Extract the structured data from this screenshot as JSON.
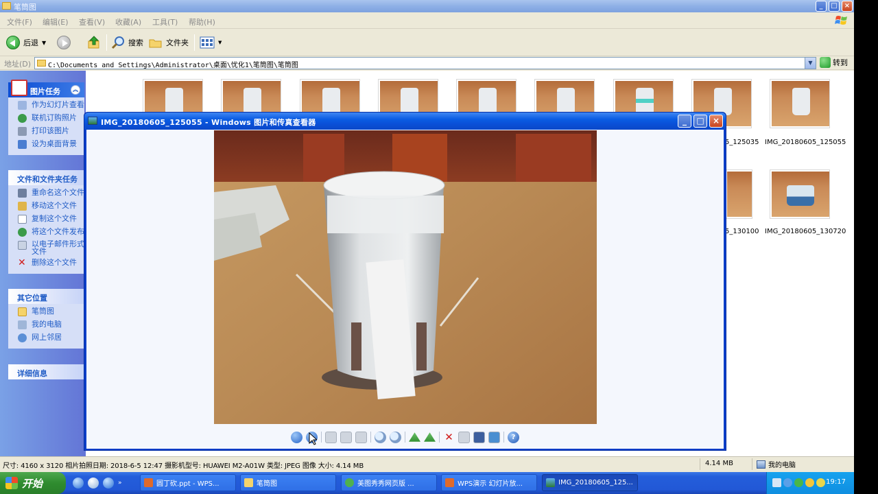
{
  "explorer": {
    "title": "笔筒图",
    "menu": [
      "文件(F)",
      "编辑(E)",
      "查看(V)",
      "收藏(A)",
      "工具(T)",
      "帮助(H)"
    ],
    "toolbar": {
      "back": "后退",
      "search": "搜索",
      "folders": "文件夹"
    },
    "address_label": "地址(D)",
    "address_path": "C:\\Documents and Settings\\Administrator\\桌面\\忧化1\\笔筒图\\笔筒图",
    "go_label": "转到"
  },
  "tasks": {
    "picture_tasks": {
      "title": "图片任务",
      "items": [
        "作为幻灯片查看",
        "联机订购照片",
        "打印该图片",
        "设为桌面背景"
      ]
    },
    "file_tasks": {
      "title": "文件和文件夹任务",
      "items": [
        "重命名这个文件",
        "移动这个文件",
        "复制这个文件",
        "将这个文件发布",
        "以电子邮件形式文件",
        "删除这个文件"
      ]
    },
    "other_places": {
      "title": "其它位置",
      "items": [
        "笔筒图",
        "我的电脑",
        "网上邻居"
      ]
    },
    "details": {
      "title": "详细信息"
    }
  },
  "thumbnails": {
    "row1_labels": [
      "5_125035",
      "IMG_20180605_125055"
    ],
    "row2_labels": [
      "5_130100",
      "IMG_20180605_130720"
    ]
  },
  "viewer": {
    "title": "IMG_20180605_125055 - Windows 图片和传真查看器"
  },
  "statusbar": {
    "info": "尺寸: 4160 x 3120 相片拍照日期: 2018-6-5 12:47 摄影机型号: HUAWEI M2-A01W 类型: JPEG 图像 大小: 4.14 MB",
    "size": "4.14 MB",
    "zone": "我的电脑"
  },
  "taskbar": {
    "start": "开始",
    "tasks": [
      "圆丁砍.ppt - WPS...",
      "笔筒图",
      "美图秀秀网页版 ...",
      "WPS演示 幻灯片放...",
      "IMG_20180605_125..."
    ],
    "clock": "19:17"
  },
  "colors": {
    "xp_blue": "#0a5ce3",
    "task_pane": "#6375d6",
    "start_green": "#2f8c2f"
  }
}
